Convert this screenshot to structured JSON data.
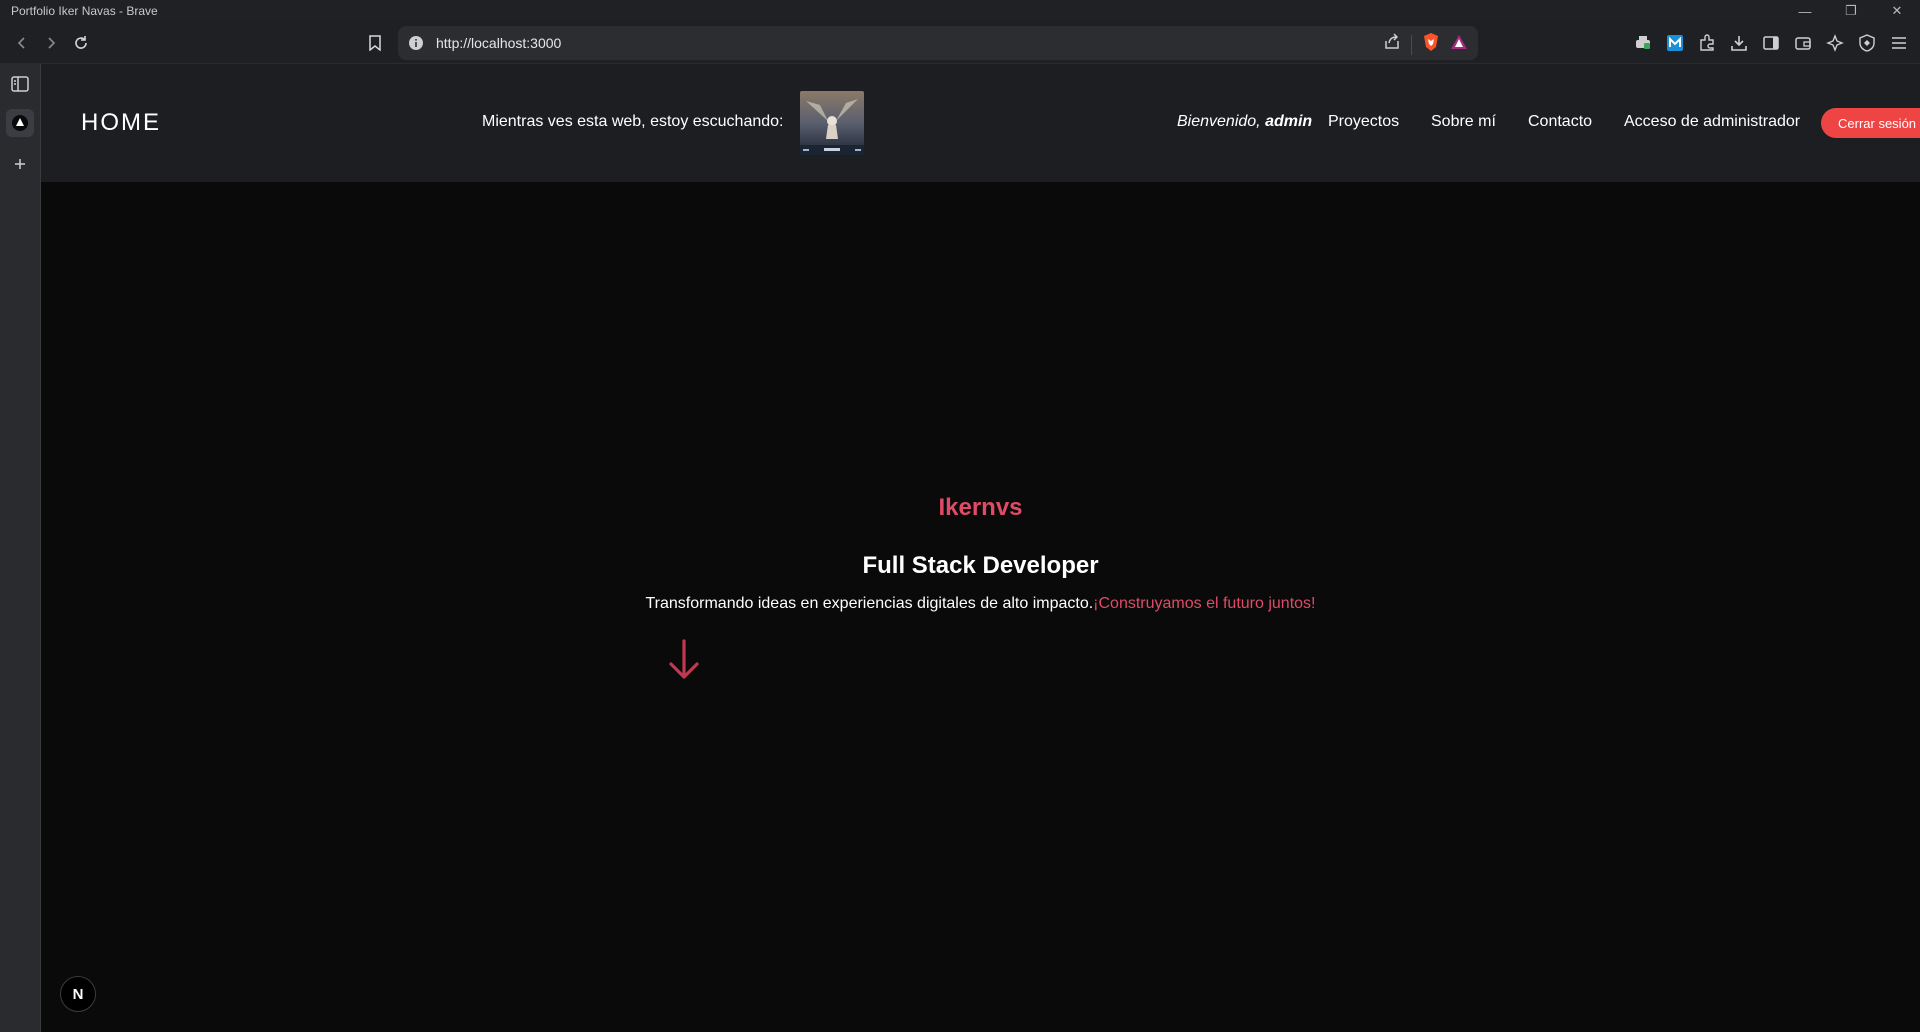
{
  "window": {
    "title": "Portfolio Iker Navas - Brave"
  },
  "browser": {
    "url": "http://localhost:3000",
    "icons": [
      "back-icon",
      "forward-icon",
      "reload-icon",
      "bookmark-icon",
      "info-icon",
      "share-icon",
      "brave-shields-icon",
      "brave-rewards-icon",
      "extensions-icon",
      "download-icon",
      "sidebar-icon",
      "wallet-icon",
      "leo-ai-icon",
      "vpn-icon",
      "menu-icon"
    ]
  },
  "nav": {
    "home": "HOME",
    "listening_label": "Mientras ves esta web, estoy escuchando:",
    "welcome_prefix": "Bienvenido,",
    "welcome_user": "admin",
    "links": [
      "Proyectos",
      "Sobre mí",
      "Contacto",
      "Acceso de administrador"
    ],
    "logout": "Cerrar sesión"
  },
  "hero": {
    "name": "Ikernvs",
    "title": "Full Stack Developer",
    "subtitle": "Transformando ideas en experiencias digitales de alto impacto.",
    "subtitle_accent": "¡Construyamos el futuro juntos!"
  },
  "badge": {
    "label": "N"
  },
  "colors": {
    "accent": "#e04a66",
    "logout": "#ef4444",
    "nav_bg": "#1c1e22",
    "page_bg": "#0a0a0b"
  }
}
